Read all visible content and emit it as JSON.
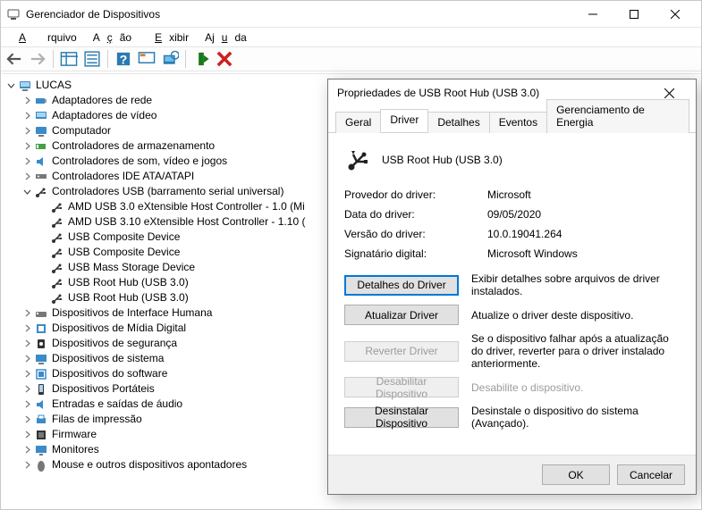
{
  "window": {
    "title": "Gerenciador de Dispositivos"
  },
  "menu": {
    "file": "Arquivo",
    "action": "Ação",
    "view": "Exibir",
    "help": "Ajuda"
  },
  "tree": {
    "root": "LUCAS",
    "nodes": {
      "net": "Adaptadores de rede",
      "video": "Adaptadores de vídeo",
      "computer": "Computador",
      "storage": "Controladores de armazenamento",
      "sound": "Controladores de som, vídeo e jogos",
      "ide": "Controladores IDE ATA/ATAPI",
      "usb": "Controladores USB (barramento serial universal)",
      "usb_items": [
        "AMD USB 3.0 eXtensible Host Controller - 1.0 (Mi",
        "AMD USB 3.10 eXtensible Host Controller - 1.10 (",
        "USB Composite Device",
        "USB Composite Device",
        "USB Mass Storage Device",
        "USB Root Hub (USB 3.0)",
        "USB Root Hub (USB 3.0)"
      ],
      "hid": "Dispositivos de Interface Humana",
      "media": "Dispositivos de Mídia Digital",
      "security": "Dispositivos de segurança",
      "system": "Dispositivos de sistema",
      "software": "Dispositivos do software",
      "portable": "Dispositivos Portáteis",
      "audio": "Entradas e saídas de áudio",
      "printq": "Filas de impressão",
      "firmware": "Firmware",
      "monitors": "Monitores",
      "mouse": "Mouse e outros dispositivos apontadores"
    }
  },
  "dialog": {
    "title": "Propriedades de USB Root Hub (USB 3.0)",
    "tabs": {
      "general": "Geral",
      "driver": "Driver",
      "details": "Detalhes",
      "events": "Eventos",
      "power": "Gerenciamento de Energia"
    },
    "device_name": "USB Root Hub (USB 3.0)",
    "info": {
      "provider_k": "Provedor do driver:",
      "provider_v": "Microsoft",
      "date_k": "Data do driver:",
      "date_v": "09/05/2020",
      "version_k": "Versão do driver:",
      "version_v": "10.0.19041.264",
      "signer_k": "Signatário digital:",
      "signer_v": "Microsoft Windows"
    },
    "buttons": {
      "details": "Detalhes do Driver",
      "details_desc": "Exibir detalhes sobre arquivos de driver instalados.",
      "update": "Atualizar Driver",
      "update_desc": "Atualize o driver deste dispositivo.",
      "rollback": "Reverter Driver",
      "rollback_desc": "Se o dispositivo falhar após a atualização do driver, reverter para o driver instalado anteriormente.",
      "disable": "Desabilitar Dispositivo",
      "disable_desc": "Desabilite o dispositivo.",
      "uninstall": "Desinstalar Dispositivo",
      "uninstall_desc": "Desinstale o dispositivo do sistema (Avançado)."
    },
    "footer": {
      "ok": "OK",
      "cancel": "Cancelar"
    }
  }
}
